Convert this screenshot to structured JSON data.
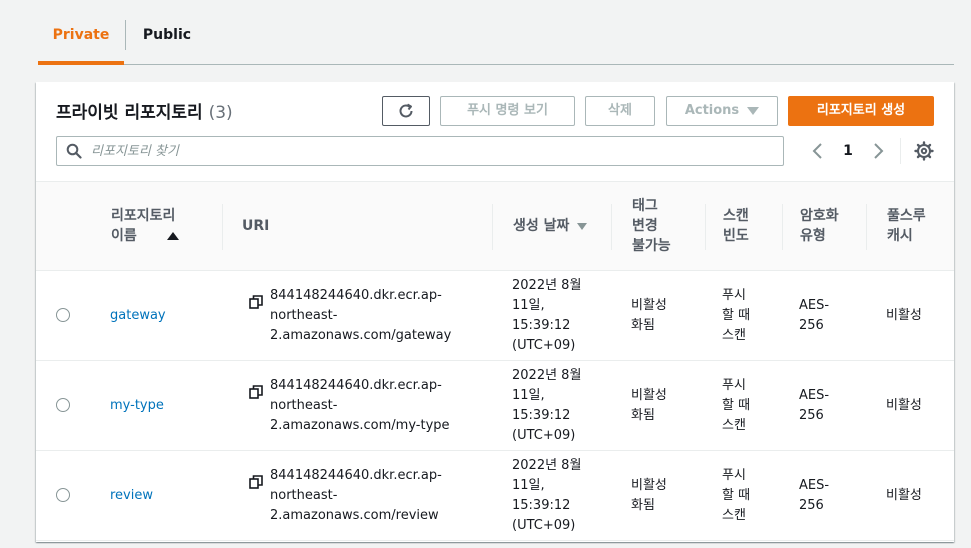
{
  "tabs": [
    {
      "label": "Private",
      "active": true
    },
    {
      "label": "Public",
      "active": false
    }
  ],
  "panel": {
    "title": "프라이빗 리포지토리",
    "count": "(3)"
  },
  "toolbar": {
    "refresh_icon": "refresh-icon",
    "push_label": "푸시 명령 보기",
    "delete_label": "삭제",
    "actions_label": "Actions",
    "create_label": "리포지토리 생성"
  },
  "search": {
    "placeholder": "리포지토리 찾기",
    "value": ""
  },
  "pagination": {
    "current": "1"
  },
  "columns": [
    {
      "line1": "리포지토리",
      "line2": "이름",
      "sort": "asc"
    },
    {
      "line1": "URI"
    },
    {
      "line1": "생성 날짜",
      "sort": "desc"
    },
    {
      "line1": "태그",
      "line2": "변경",
      "line3": "불가능"
    },
    {
      "line1": "스캔",
      "line2": "빈도"
    },
    {
      "line1": "암호화",
      "line2": "유형"
    },
    {
      "line1": "풀스루",
      "line2": "캐시"
    }
  ],
  "rows": [
    {
      "name": "gateway",
      "uri": [
        "844148244640.dkr.ecr.ap-",
        "northeast-",
        "2.amazonaws.com/gateway"
      ],
      "created": [
        "2022년 8월",
        "11일,",
        "15:39:12",
        "(UTC+09)"
      ],
      "tag_immutable": [
        "비활성",
        "화됨"
      ],
      "scan": [
        "푸시",
        "할 때",
        "스캔"
      ],
      "encryption": [
        "AES-",
        "256"
      ],
      "pull_through": "비활성"
    },
    {
      "name": "my-type",
      "uri": [
        "844148244640.dkr.ecr.ap-",
        "northeast-",
        "2.amazonaws.com/my-type"
      ],
      "created": [
        "2022년 8월",
        "11일,",
        "15:39:12",
        "(UTC+09)"
      ],
      "tag_immutable": [
        "비활성",
        "화됨"
      ],
      "scan": [
        "푸시",
        "할 때",
        "스캔"
      ],
      "encryption": [
        "AES-",
        "256"
      ],
      "pull_through": "비활성"
    },
    {
      "name": "review",
      "uri": [
        "844148244640.dkr.ecr.ap-",
        "northeast-",
        "2.amazonaws.com/review"
      ],
      "created": [
        "2022년 8월",
        "11일,",
        "15:39:12",
        "(UTC+09)"
      ],
      "tag_immutable": [
        "비활성",
        "화됨"
      ],
      "scan": [
        "푸시",
        "할 때",
        "스캔"
      ],
      "encryption": [
        "AES-",
        "256"
      ],
      "pull_through": "비활성"
    }
  ],
  "colors": {
    "accent": "#ec7211",
    "link": "#0073bb",
    "text": "#16191f",
    "muted": "#545b64"
  }
}
